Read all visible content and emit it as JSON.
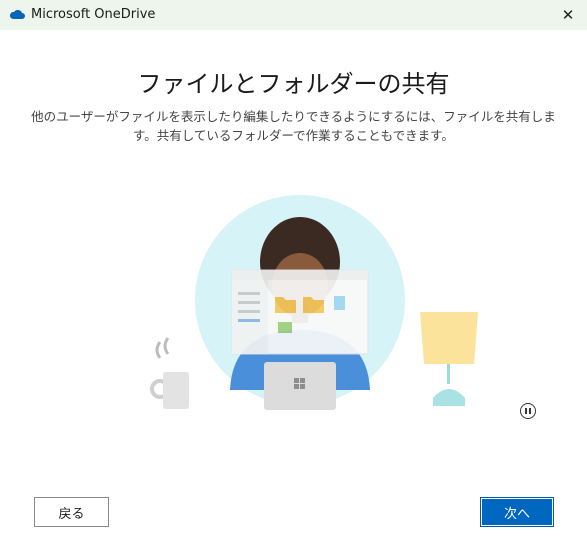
{
  "window": {
    "title": "Microsoft OneDrive",
    "close_glyph": "✕"
  },
  "page": {
    "heading": "ファイルとフォルダーの共有",
    "description": "他のユーザーがファイルを表示したり編集したりできるようにするには、ファイルを共有します。共有しているフォルダーで作業することもできます。"
  },
  "buttons": {
    "back": "戻る",
    "next": "次へ"
  },
  "colors": {
    "accent": "#0067c0",
    "titlebar": "#eef5ec",
    "circle": "#d6f3f8",
    "cloud": "#0364b8"
  },
  "icons": [
    "onedrive-cloud-icon",
    "close-icon",
    "pause-icon"
  ]
}
